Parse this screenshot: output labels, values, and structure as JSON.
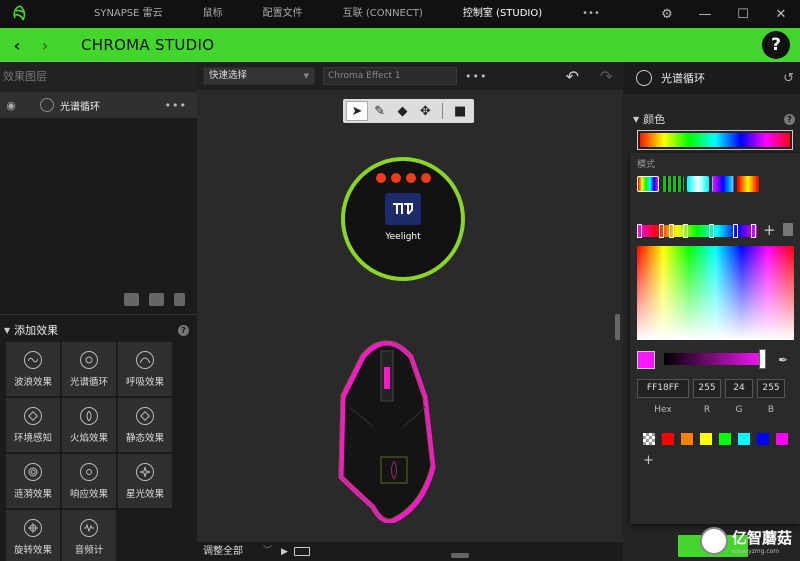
{
  "titlebar": {
    "tabs": [
      "SYNAPSE 雷云",
      "鼠标",
      "配置文件",
      "互联 (CONNECT)",
      "控制室 (STUDIO)",
      "•••"
    ],
    "active_tab": 4
  },
  "header": {
    "title": "CHROMA STUDIO",
    "help": "?"
  },
  "layers": {
    "heading": "效果图层",
    "items": [
      {
        "label": "光谱循环",
        "more": "•••"
      }
    ]
  },
  "add_effects": {
    "heading": "添加效果",
    "help": "?",
    "items": [
      {
        "label": "波浪效果",
        "icon": "wave-icon"
      },
      {
        "label": "光谱循环",
        "icon": "spectrum-icon"
      },
      {
        "label": "呼吸效果",
        "icon": "breath-icon"
      },
      {
        "label": "环境感知",
        "icon": "ambient-icon"
      },
      {
        "label": "火焰效果",
        "icon": "fire-icon"
      },
      {
        "label": "静态效果",
        "icon": "static-icon"
      },
      {
        "label": "涟漪效果",
        "icon": "ripple-icon"
      },
      {
        "label": "响应效果",
        "icon": "reactive-icon"
      },
      {
        "label": "星光效果",
        "icon": "starlight-icon"
      },
      {
        "label": "旋转效果",
        "icon": "wheel-icon"
      },
      {
        "label": "音频计",
        "icon": "audio-meter-icon"
      }
    ]
  },
  "canvas": {
    "quick_select": "快速选择",
    "effect_name": "Chroma Effect 1",
    "more": "•••",
    "device_label": "Yeelight",
    "adjust_all": "调整全部",
    "brand_color": "#44d62c",
    "glow_color": "#ff18c8"
  },
  "right": {
    "title": "光谱循环",
    "color_heading": "颜色",
    "help": "?",
    "mode_label": "模式",
    "hex": "FF18FF",
    "r": "255",
    "g": "24",
    "b": "255",
    "labels": {
      "hex": "Hex",
      "r": "R",
      "g": "G",
      "b": "B"
    },
    "preset_colors": [
      "transparent",
      "#ff0000",
      "#ff8000",
      "#ffff00",
      "#00ff00",
      "#00ffff",
      "#0000ff",
      "#ff00ff"
    ],
    "add": "+"
  },
  "watermark": {
    "name": "亿智蘑菇",
    "url": "www.yzmg.com"
  }
}
